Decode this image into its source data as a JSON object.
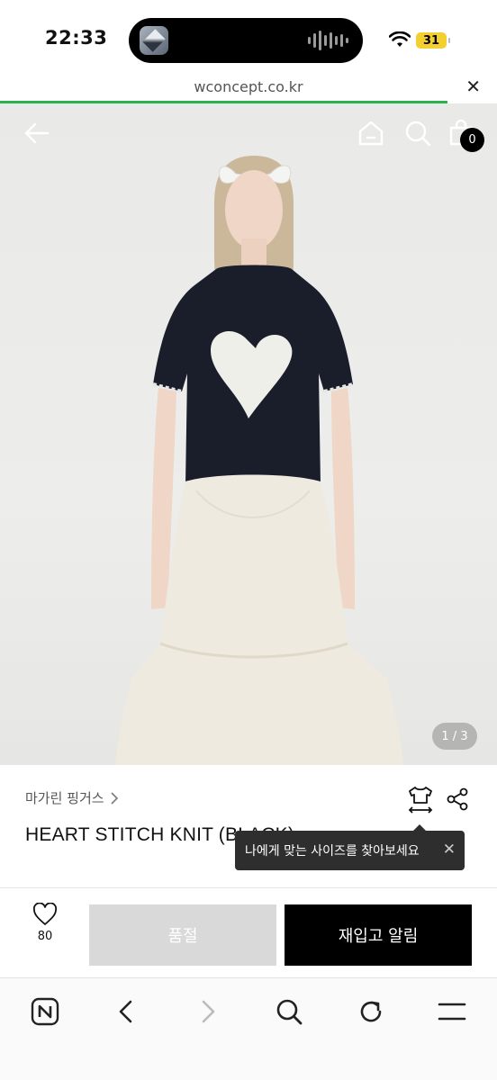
{
  "status_bar": {
    "time": "22:33",
    "battery_level": "31",
    "battery_color": "#f3d02f"
  },
  "browser": {
    "url": "wconcept.co.kr",
    "load_progress": 0.9,
    "progress_color": "#2bb24c"
  },
  "hero": {
    "cart_count": "0",
    "page_indicator": "1 / 3",
    "icons": [
      "back-arrow-icon",
      "home-icon",
      "search-icon",
      "shopping-bag-icon"
    ]
  },
  "product": {
    "brand": "마가린 핑거스",
    "name": "HEART STITCH KNIT (BLACK)",
    "tooltip": "나에게 맞는 사이즈를 찾아보세요"
  },
  "actions": {
    "wish_count": "80",
    "soldout_label": "품절",
    "restock_label": "재입고 알림"
  },
  "toolbar": {
    "icons": [
      "naver-home-icon",
      "back-icon",
      "forward-icon",
      "search-icon",
      "refresh-icon",
      "menu-icon"
    ]
  }
}
